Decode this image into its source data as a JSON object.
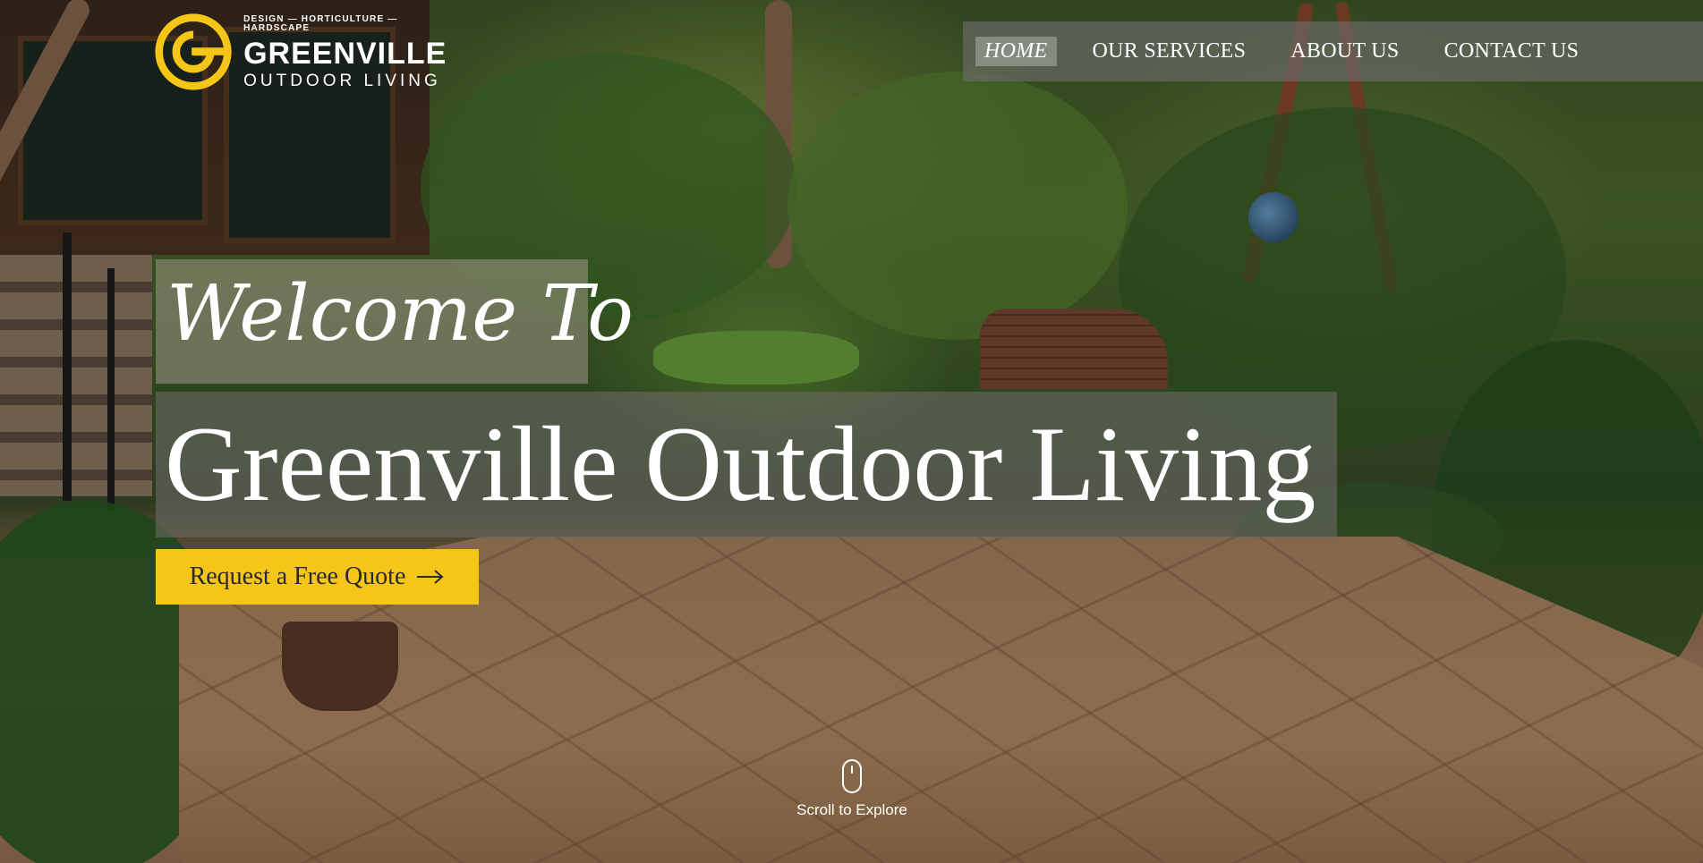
{
  "brand": {
    "tagline": "DESIGN — HORTICULTURE — HARDSCAPE",
    "name": "GREENVILLE",
    "subname": "OUTDOOR LIVING",
    "logo_icon": "greenville-g-logo-icon",
    "accent_color": "#f5c518"
  },
  "nav": {
    "items": [
      {
        "label": "HOME",
        "active": true
      },
      {
        "label": "OUR SERVICES",
        "active": false
      },
      {
        "label": "ABOUT US",
        "active": false
      },
      {
        "label": "CONTACT US",
        "active": false
      }
    ]
  },
  "hero": {
    "welcome": "Welcome To",
    "title": "Greenville Outdoor Living",
    "cta_label": "Request a Free Quote",
    "cta_icon": "arrow-right-icon",
    "cta_color": "#f5c518"
  },
  "scroll": {
    "label": "Scroll to Explore",
    "icon": "mouse-icon"
  }
}
